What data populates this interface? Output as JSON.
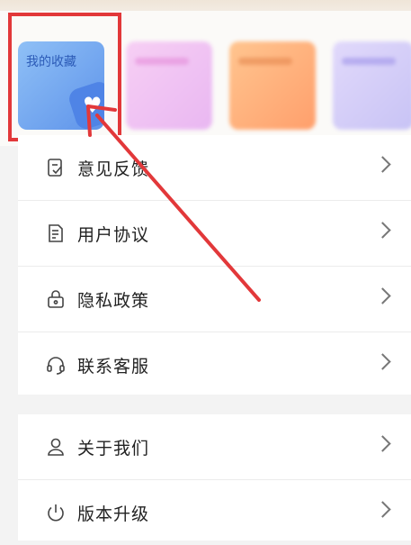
{
  "favorites_card": {
    "label": "我的收藏"
  },
  "menu_group_1": [
    {
      "label": "意见反馈",
      "icon": "feedback-icon"
    },
    {
      "label": "用户协议",
      "icon": "document-icon"
    },
    {
      "label": "隐私政策",
      "icon": "lock-icon"
    },
    {
      "label": "联系客服",
      "icon": "headset-icon"
    }
  ],
  "menu_group_2": [
    {
      "label": "关于我们",
      "icon": "user-icon"
    },
    {
      "label": "版本升级",
      "icon": "power-icon"
    }
  ],
  "colors": {
    "highlight": "#e2383a",
    "card_blue": "#5e93ea"
  }
}
